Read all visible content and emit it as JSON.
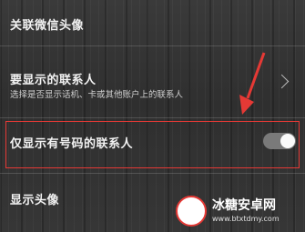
{
  "settings": {
    "items": [
      {
        "title": "关联微信头像"
      },
      {
        "title": "要显示的联系人",
        "subtitle": "选择是否显示话机、卡或其他账户上的联系人"
      },
      {
        "title": "仅显示有号码的联系人",
        "toggle_on": false
      },
      {
        "title": "显示头像"
      }
    ]
  },
  "watermark": {
    "name": "冰糖安卓网",
    "url": "www.btxtdmy.com"
  },
  "colors": {
    "highlight": "#e53935",
    "arrow": "#e53935"
  }
}
